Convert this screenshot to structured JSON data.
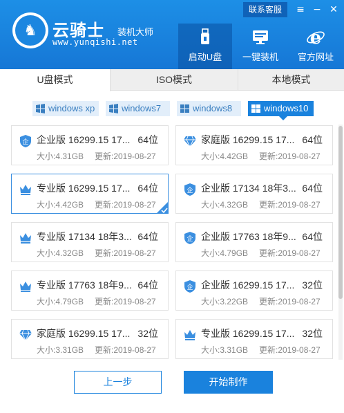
{
  "brand": {
    "title": "云骑士",
    "subtitle": "装机大师",
    "url": "www.yunqishi.net"
  },
  "header": {
    "contact_label": "联系客服",
    "menu_icon": "menu-icon",
    "minimize_icon": "minimize-icon",
    "close_icon": "close-icon"
  },
  "nav": [
    {
      "label": "启动U盘",
      "icon": "usb-drive-icon",
      "active": true
    },
    {
      "label": "一键装机",
      "icon": "monitor-icon",
      "active": false
    },
    {
      "label": "官方网址",
      "icon": "ie-browser-icon",
      "active": false
    }
  ],
  "tabs": [
    {
      "label": "U盘模式",
      "active": true
    },
    {
      "label": "ISO模式",
      "active": false
    },
    {
      "label": "本地模式",
      "active": false
    }
  ],
  "filters": [
    {
      "label": "windows xp",
      "active": false
    },
    {
      "label": "windows7",
      "active": false
    },
    {
      "label": "windows8",
      "active": false
    },
    {
      "label": "windows10",
      "active": true
    }
  ],
  "size_prefix": "大小:",
  "date_prefix": "更新:",
  "cards": [
    {
      "icon": "shield-enterprise-icon",
      "name": "企业版 16299.15 17...",
      "bits": "64位",
      "size": "大小:4.31GB",
      "date": "更新:2019-08-27",
      "selected": false
    },
    {
      "icon": "diamond-home-icon",
      "name": "家庭版 16299.15 17...",
      "bits": "64位",
      "size": "大小:4.42GB",
      "date": "更新:2019-08-27",
      "selected": false
    },
    {
      "icon": "crown-pro-icon",
      "name": "专业版 16299.15 17...",
      "bits": "64位",
      "size": "大小:4.42GB",
      "date": "更新:2019-08-27",
      "selected": true
    },
    {
      "icon": "shield-enterprise-icon",
      "name": "企业版 17134 18年3...",
      "bits": "64位",
      "size": "大小:4.32GB",
      "date": "更新:2019-08-27",
      "selected": false
    },
    {
      "icon": "crown-pro-icon",
      "name": "专业版 17134 18年3...",
      "bits": "64位",
      "size": "大小:4.32GB",
      "date": "更新:2019-08-27",
      "selected": false
    },
    {
      "icon": "shield-enterprise-icon",
      "name": "企业版 17763 18年9...",
      "bits": "64位",
      "size": "大小:4.79GB",
      "date": "更新:2019-08-27",
      "selected": false
    },
    {
      "icon": "crown-pro-icon",
      "name": "专业版 17763 18年9...",
      "bits": "64位",
      "size": "大小:4.79GB",
      "date": "更新:2019-08-27",
      "selected": false
    },
    {
      "icon": "shield-enterprise-icon",
      "name": "企业版 16299.15 17...",
      "bits": "32位",
      "size": "大小:3.22GB",
      "date": "更新:2019-08-27",
      "selected": false
    },
    {
      "icon": "diamond-home-icon",
      "name": "家庭版 16299.15 17...",
      "bits": "32位",
      "size": "大小:3.31GB",
      "date": "更新:2019-08-27",
      "selected": false
    },
    {
      "icon": "crown-pro-icon",
      "name": "专业版 16299.15 17...",
      "bits": "32位",
      "size": "大小:3.31GB",
      "date": "更新:2019-08-27",
      "selected": false
    }
  ],
  "buttons": {
    "prev": "上一步",
    "start": "开始制作"
  },
  "colors": {
    "brand_blue": "#1a82dd",
    "header_blue": "#1d8fe6"
  }
}
